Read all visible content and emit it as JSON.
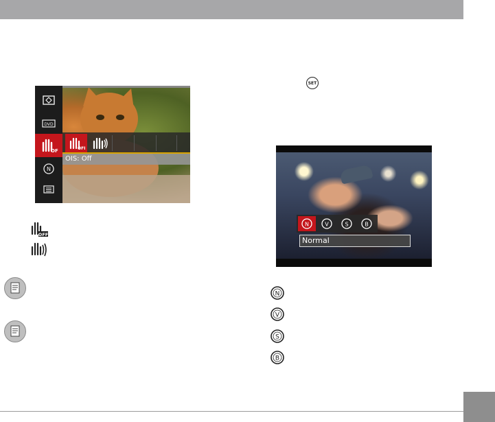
{
  "screen1": {
    "ois_option_label": "OIS: Off"
  },
  "screen2": {
    "color_option_label": "Normal"
  },
  "set_button": {
    "label": "SET"
  },
  "colors": {
    "header_bar": "#a7a7a9",
    "menu_highlight": "#c4161c",
    "page_tab": "#8e8e8e"
  },
  "icons": {
    "ois_menu": [
      "exposure-icon",
      "dvd-icon",
      "ois-off-icon",
      "color-icon",
      "menu-icon"
    ],
    "ois_legend": [
      "ois-off-icon",
      "ois-on-icon"
    ],
    "notes": [
      "note-icon",
      "note-icon"
    ],
    "color_legend": [
      "color-normal-icon",
      "color-vivid-icon",
      "color-sepia-icon",
      "color-bw-icon"
    ]
  }
}
